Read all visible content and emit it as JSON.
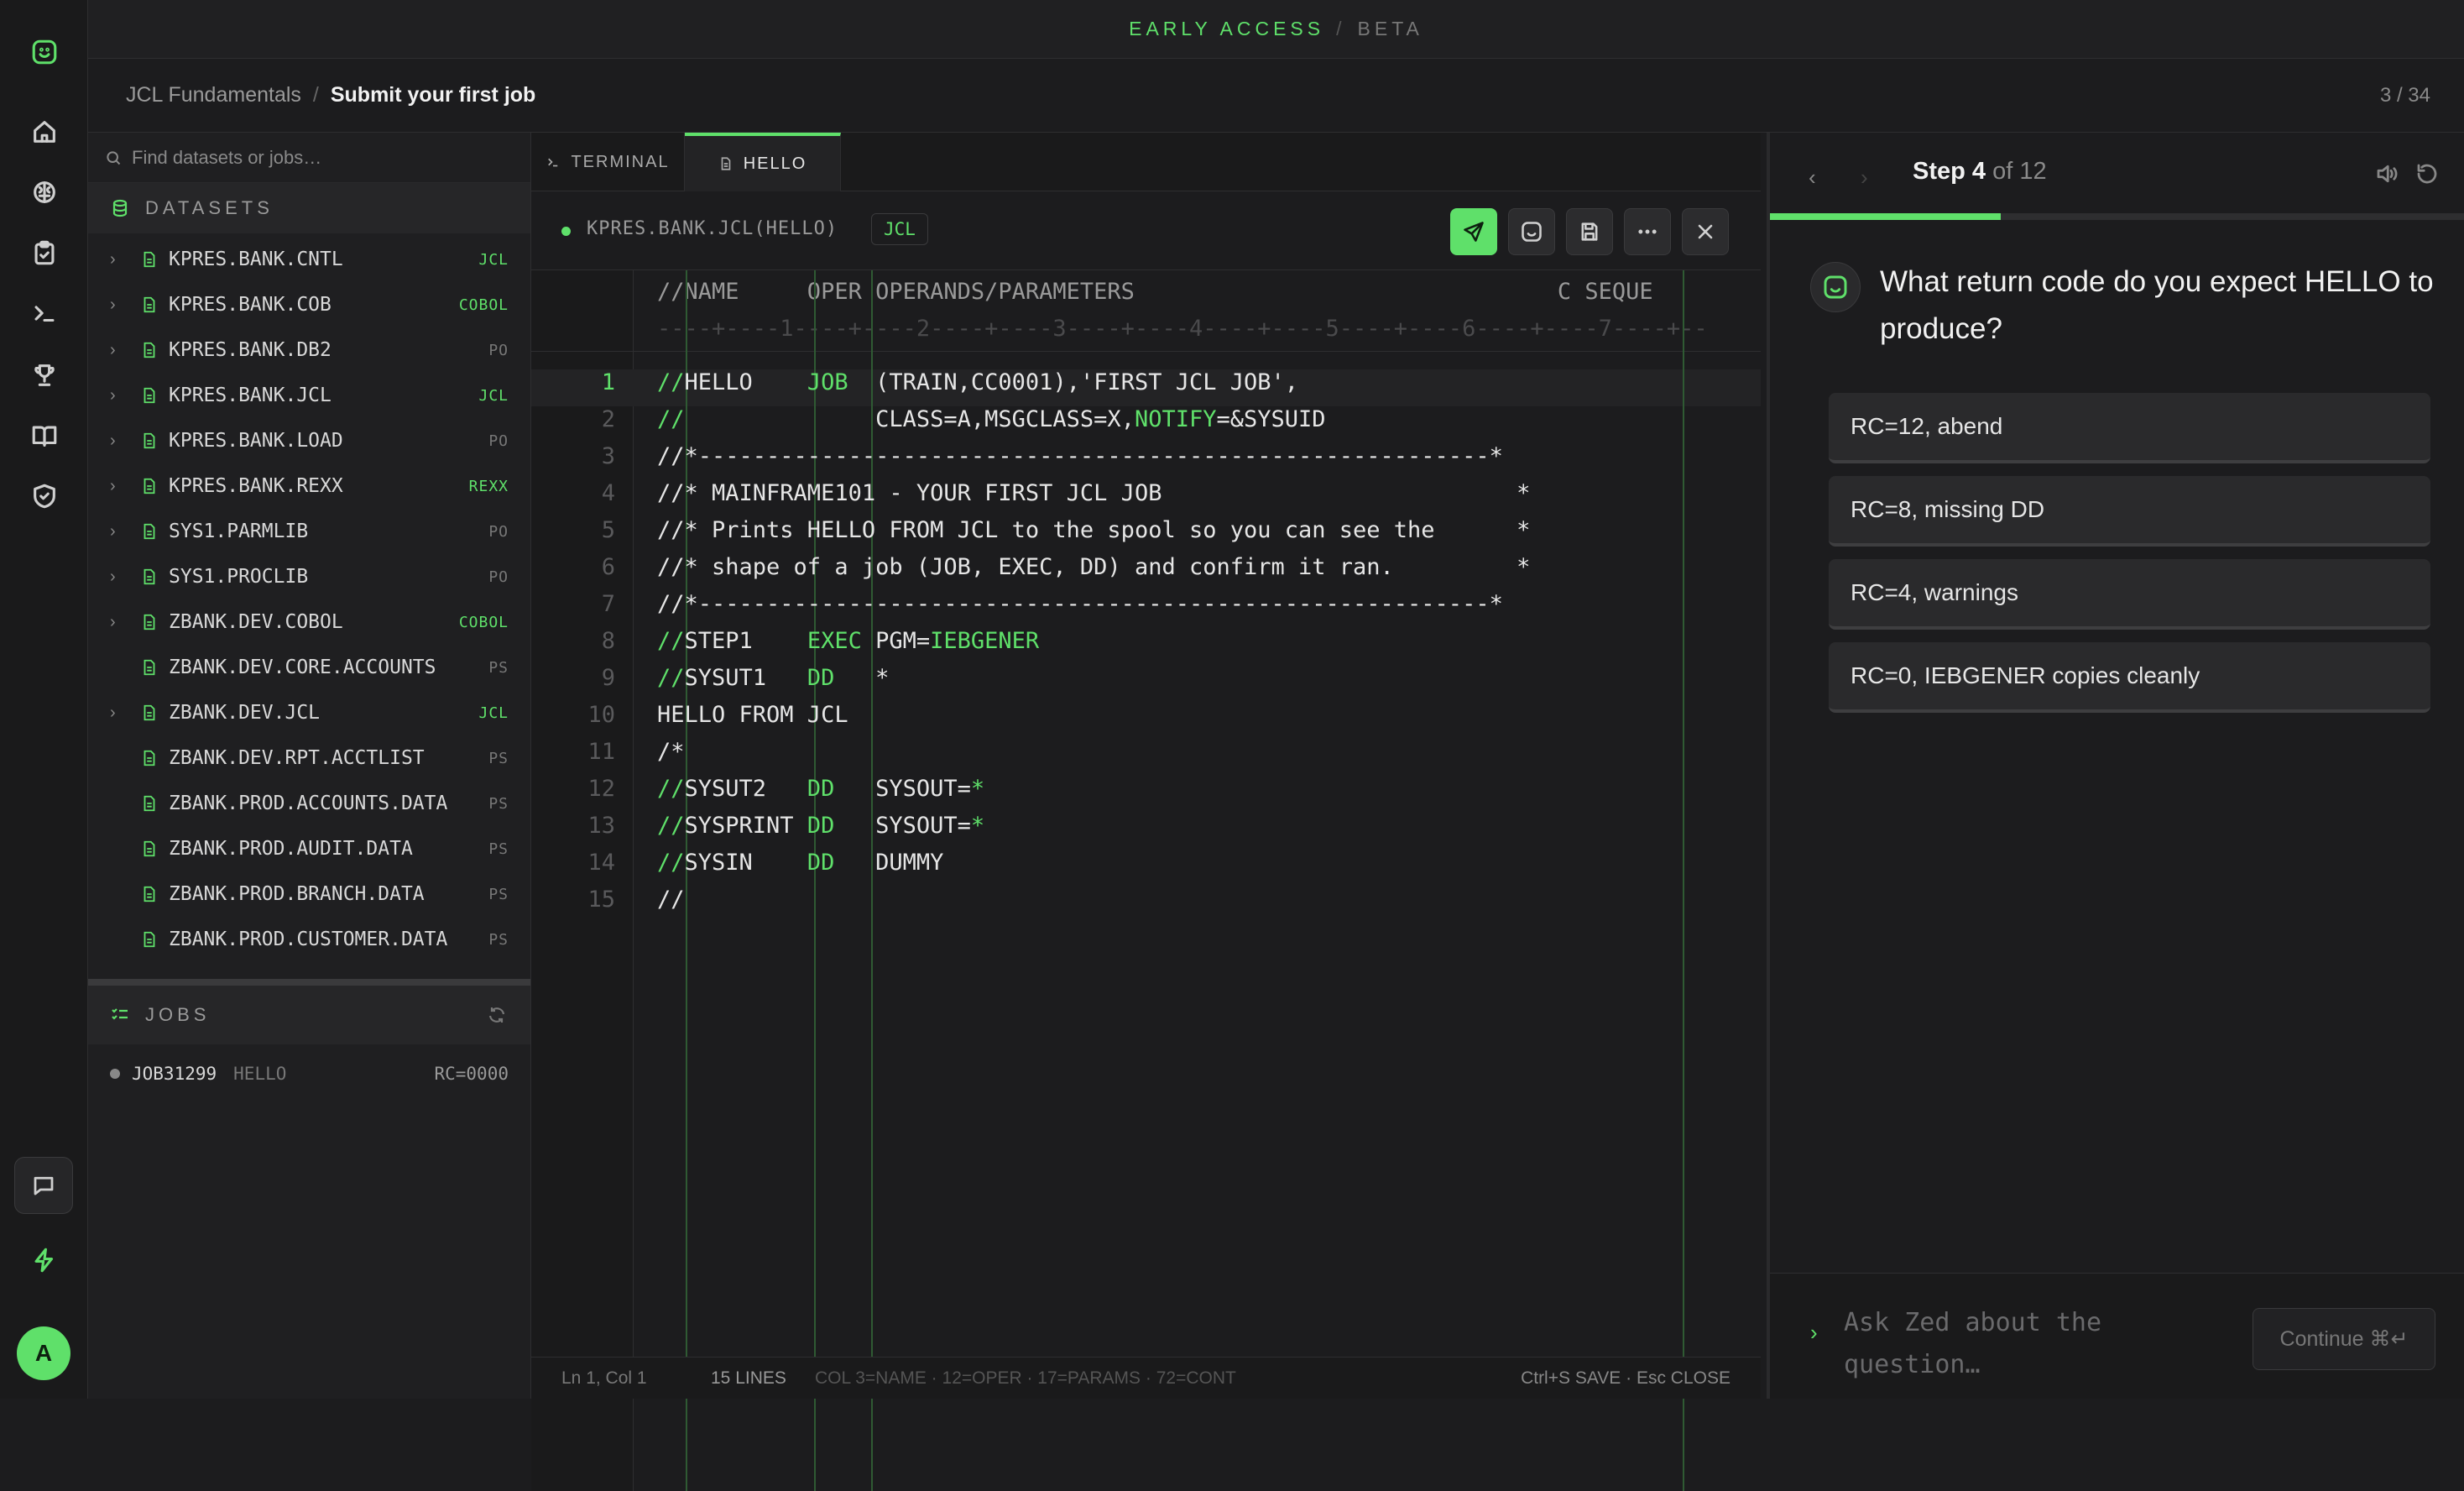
{
  "banner": {
    "left": "EARLY ACCESS",
    "sep": "/",
    "right": "BETA"
  },
  "breadcrumb": {
    "course": "JCL Fundamentals",
    "sep": "/",
    "lesson": "Submit your first job",
    "progress": "3 / 34"
  },
  "datasets": {
    "search_placeholder": "Find datasets or jobs…",
    "header": "DATASETS",
    "items": [
      {
        "name": "KPRES.BANK.CNTL",
        "tag": "JCL",
        "expandable": true,
        "tag_accent": true
      },
      {
        "name": "KPRES.BANK.COB",
        "tag": "COBOL",
        "expandable": true,
        "tag_accent": true
      },
      {
        "name": "KPRES.BANK.DB2",
        "tag": "PO",
        "expandable": true,
        "tag_accent": false
      },
      {
        "name": "KPRES.BANK.JCL",
        "tag": "JCL",
        "expandable": true,
        "tag_accent": true
      },
      {
        "name": "KPRES.BANK.LOAD",
        "tag": "PO",
        "expandable": true,
        "tag_accent": false
      },
      {
        "name": "KPRES.BANK.REXX",
        "tag": "REXX",
        "expandable": true,
        "tag_accent": true
      },
      {
        "name": "SYS1.PARMLIB",
        "tag": "PO",
        "expandable": true,
        "tag_accent": false
      },
      {
        "name": "SYS1.PROCLIB",
        "tag": "PO",
        "expandable": true,
        "tag_accent": false
      },
      {
        "name": "ZBANK.DEV.COBOL",
        "tag": "COBOL",
        "expandable": true,
        "tag_accent": true
      },
      {
        "name": "ZBANK.DEV.CORE.ACCOUNTS",
        "tag": "PS",
        "expandable": false,
        "tag_accent": false
      },
      {
        "name": "ZBANK.DEV.JCL",
        "tag": "JCL",
        "expandable": true,
        "tag_accent": true
      },
      {
        "name": "ZBANK.DEV.RPT.ACCTLIST",
        "tag": "PS",
        "expandable": false,
        "tag_accent": false
      },
      {
        "name": "ZBANK.PROD.ACCOUNTS.DATA",
        "tag": "PS",
        "expandable": false,
        "tag_accent": false
      },
      {
        "name": "ZBANK.PROD.AUDIT.DATA",
        "tag": "PS",
        "expandable": false,
        "tag_accent": false
      },
      {
        "name": "ZBANK.PROD.BRANCH.DATA",
        "tag": "PS",
        "expandable": false,
        "tag_accent": false
      },
      {
        "name": "ZBANK.PROD.CUSTOMER.DATA",
        "tag": "PS",
        "expandable": false,
        "tag_accent": false
      }
    ]
  },
  "jobs": {
    "header": "JOBS",
    "items": [
      {
        "id": "JOB31299",
        "name": "HELLO",
        "rc": "RC=0000"
      }
    ]
  },
  "editor": {
    "tabs": [
      {
        "label": "TERMINAL",
        "icon": "terminal-icon"
      },
      {
        "label": "HELLO",
        "icon": "file-icon"
      }
    ],
    "file_name": "KPRES.BANK.JCL(HELLO)",
    "file_lang": "JCL",
    "header_row": "//NAME     OPER OPERANDS/PARAMETERS                               C SEQUE",
    "ruler_row": "----+----1----+----2----+----3----+----4----+----5----+----6----+----7----+--",
    "status": {
      "position": "Ln 1, Col 1",
      "lines": "15 LINES",
      "columns": "COL 3=NAME · 12=OPER · 17=PARAMS · 72=CONT",
      "keys": "Ctrl+S SAVE · Esc CLOSE"
    }
  },
  "step": {
    "label": "Step 4",
    "of": "of 12",
    "progress_fraction": 0.333,
    "question": "What return code do you expect HELLO to produce?",
    "options": [
      "RC=12, abend",
      "RC=8, missing DD",
      "RC=4, warnings",
      "RC=0, IEBGENER copies cleanly"
    ],
    "ask_placeholder": "Ask Zed about the question…",
    "continue_label": "Continue ⌘↵"
  },
  "user": {
    "avatar_initial": "A"
  },
  "colors": {
    "accent": "#5fe06a",
    "background": "#1c1c1e",
    "panel": "#1f1f21"
  }
}
